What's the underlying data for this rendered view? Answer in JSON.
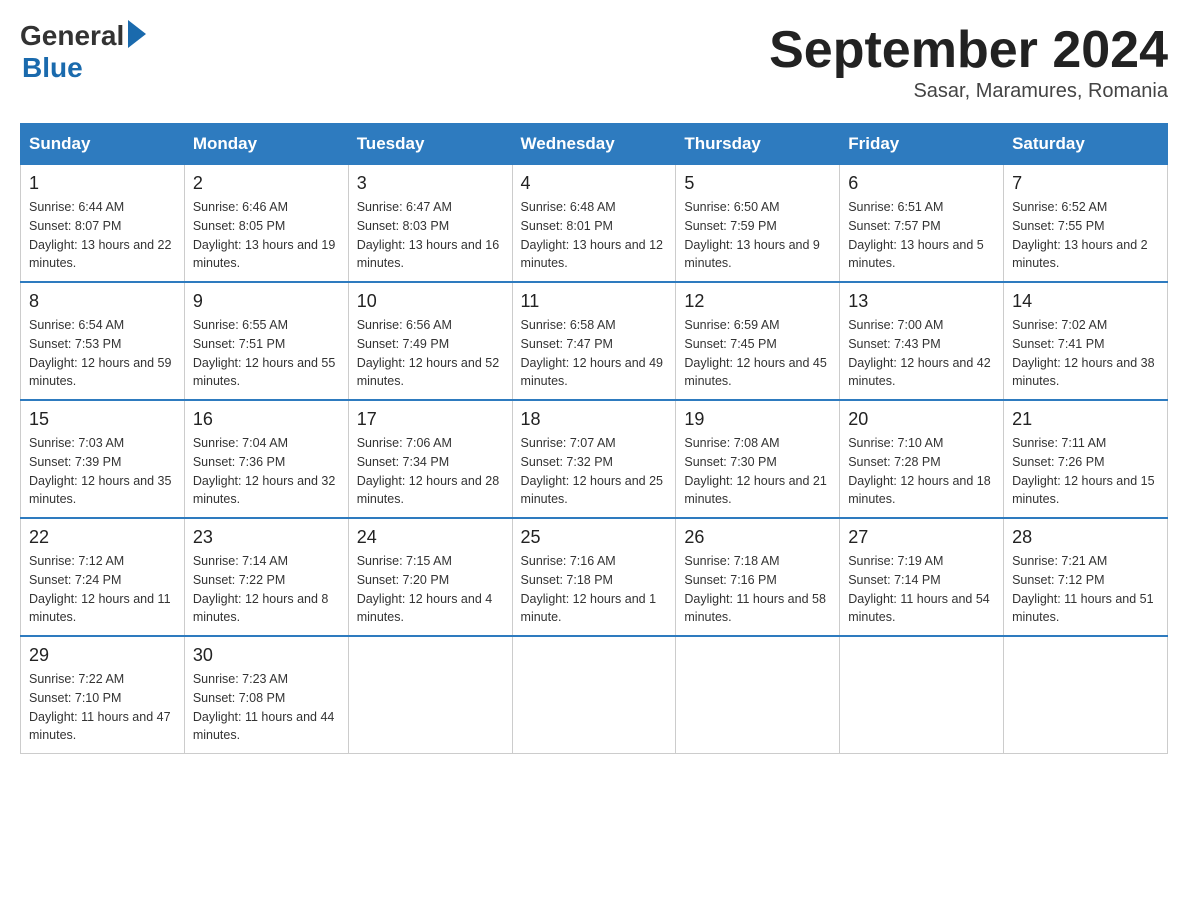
{
  "logo": {
    "general": "General",
    "blue": "Blue"
  },
  "title": "September 2024",
  "location": "Sasar, Maramures, Romania",
  "days_of_week": [
    "Sunday",
    "Monday",
    "Tuesday",
    "Wednesday",
    "Thursday",
    "Friday",
    "Saturday"
  ],
  "weeks": [
    [
      {
        "day": "1",
        "sunrise": "6:44 AM",
        "sunset": "8:07 PM",
        "daylight": "13 hours and 22 minutes."
      },
      {
        "day": "2",
        "sunrise": "6:46 AM",
        "sunset": "8:05 PM",
        "daylight": "13 hours and 19 minutes."
      },
      {
        "day": "3",
        "sunrise": "6:47 AM",
        "sunset": "8:03 PM",
        "daylight": "13 hours and 16 minutes."
      },
      {
        "day": "4",
        "sunrise": "6:48 AM",
        "sunset": "8:01 PM",
        "daylight": "13 hours and 12 minutes."
      },
      {
        "day": "5",
        "sunrise": "6:50 AM",
        "sunset": "7:59 PM",
        "daylight": "13 hours and 9 minutes."
      },
      {
        "day": "6",
        "sunrise": "6:51 AM",
        "sunset": "7:57 PM",
        "daylight": "13 hours and 5 minutes."
      },
      {
        "day": "7",
        "sunrise": "6:52 AM",
        "sunset": "7:55 PM",
        "daylight": "13 hours and 2 minutes."
      }
    ],
    [
      {
        "day": "8",
        "sunrise": "6:54 AM",
        "sunset": "7:53 PM",
        "daylight": "12 hours and 59 minutes."
      },
      {
        "day": "9",
        "sunrise": "6:55 AM",
        "sunset": "7:51 PM",
        "daylight": "12 hours and 55 minutes."
      },
      {
        "day": "10",
        "sunrise": "6:56 AM",
        "sunset": "7:49 PM",
        "daylight": "12 hours and 52 minutes."
      },
      {
        "day": "11",
        "sunrise": "6:58 AM",
        "sunset": "7:47 PM",
        "daylight": "12 hours and 49 minutes."
      },
      {
        "day": "12",
        "sunrise": "6:59 AM",
        "sunset": "7:45 PM",
        "daylight": "12 hours and 45 minutes."
      },
      {
        "day": "13",
        "sunrise": "7:00 AM",
        "sunset": "7:43 PM",
        "daylight": "12 hours and 42 minutes."
      },
      {
        "day": "14",
        "sunrise": "7:02 AM",
        "sunset": "7:41 PM",
        "daylight": "12 hours and 38 minutes."
      }
    ],
    [
      {
        "day": "15",
        "sunrise": "7:03 AM",
        "sunset": "7:39 PM",
        "daylight": "12 hours and 35 minutes."
      },
      {
        "day": "16",
        "sunrise": "7:04 AM",
        "sunset": "7:36 PM",
        "daylight": "12 hours and 32 minutes."
      },
      {
        "day": "17",
        "sunrise": "7:06 AM",
        "sunset": "7:34 PM",
        "daylight": "12 hours and 28 minutes."
      },
      {
        "day": "18",
        "sunrise": "7:07 AM",
        "sunset": "7:32 PM",
        "daylight": "12 hours and 25 minutes."
      },
      {
        "day": "19",
        "sunrise": "7:08 AM",
        "sunset": "7:30 PM",
        "daylight": "12 hours and 21 minutes."
      },
      {
        "day": "20",
        "sunrise": "7:10 AM",
        "sunset": "7:28 PM",
        "daylight": "12 hours and 18 minutes."
      },
      {
        "day": "21",
        "sunrise": "7:11 AM",
        "sunset": "7:26 PM",
        "daylight": "12 hours and 15 minutes."
      }
    ],
    [
      {
        "day": "22",
        "sunrise": "7:12 AM",
        "sunset": "7:24 PM",
        "daylight": "12 hours and 11 minutes."
      },
      {
        "day": "23",
        "sunrise": "7:14 AM",
        "sunset": "7:22 PM",
        "daylight": "12 hours and 8 minutes."
      },
      {
        "day": "24",
        "sunrise": "7:15 AM",
        "sunset": "7:20 PM",
        "daylight": "12 hours and 4 minutes."
      },
      {
        "day": "25",
        "sunrise": "7:16 AM",
        "sunset": "7:18 PM",
        "daylight": "12 hours and 1 minute."
      },
      {
        "day": "26",
        "sunrise": "7:18 AM",
        "sunset": "7:16 PM",
        "daylight": "11 hours and 58 minutes."
      },
      {
        "day": "27",
        "sunrise": "7:19 AM",
        "sunset": "7:14 PM",
        "daylight": "11 hours and 54 minutes."
      },
      {
        "day": "28",
        "sunrise": "7:21 AM",
        "sunset": "7:12 PM",
        "daylight": "11 hours and 51 minutes."
      }
    ],
    [
      {
        "day": "29",
        "sunrise": "7:22 AM",
        "sunset": "7:10 PM",
        "daylight": "11 hours and 47 minutes."
      },
      {
        "day": "30",
        "sunrise": "7:23 AM",
        "sunset": "7:08 PM",
        "daylight": "11 hours and 44 minutes."
      },
      null,
      null,
      null,
      null,
      null
    ]
  ]
}
